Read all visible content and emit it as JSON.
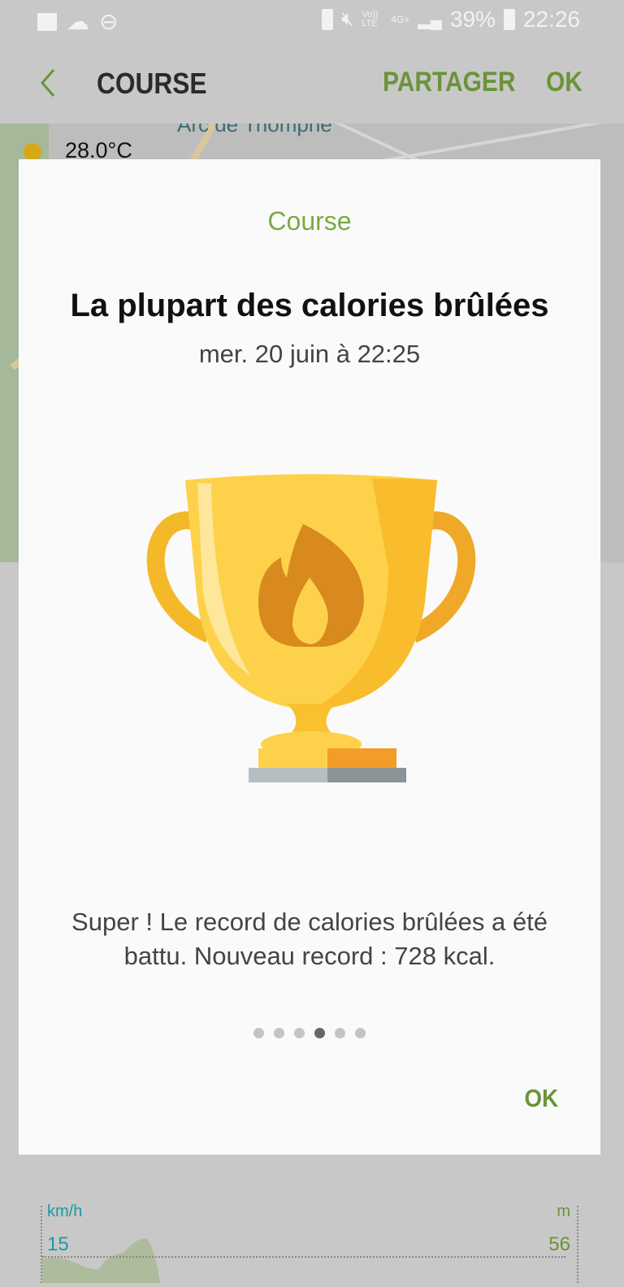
{
  "status_bar": {
    "battery": "39%",
    "time": "22:26",
    "network": "4G+",
    "volte": "Vo)) LTE",
    "icons": [
      "gallery-icon",
      "cloud-icon",
      "dnd-icon",
      "battery-saver-icon",
      "mute-icon",
      "signal-icon",
      "battery-icon"
    ]
  },
  "app_bar": {
    "title": "COURSE",
    "share_label": "PARTAGER",
    "ok_label": "OK"
  },
  "map": {
    "temperature": "28.0°C",
    "landmark": "Arc de Triomphe"
  },
  "dialog": {
    "subtitle": "Course",
    "title": "La plupart des calories brûlées",
    "date": "mer. 20 juin à 22:25",
    "message": "Super ! Le record de calories brûlées a été battu. Nouveau record : 728 kcal.",
    "page_count": 6,
    "current_page": 4,
    "ok_label": "OK",
    "icon": "trophy-flame-icon"
  },
  "chart": {
    "left_unit": "km/h",
    "right_unit": "m",
    "left_max": "15",
    "right_max": "56"
  },
  "colors": {
    "accent": "#6a9438",
    "speed": "#1b9aa0",
    "title": "#7aaa44"
  }
}
